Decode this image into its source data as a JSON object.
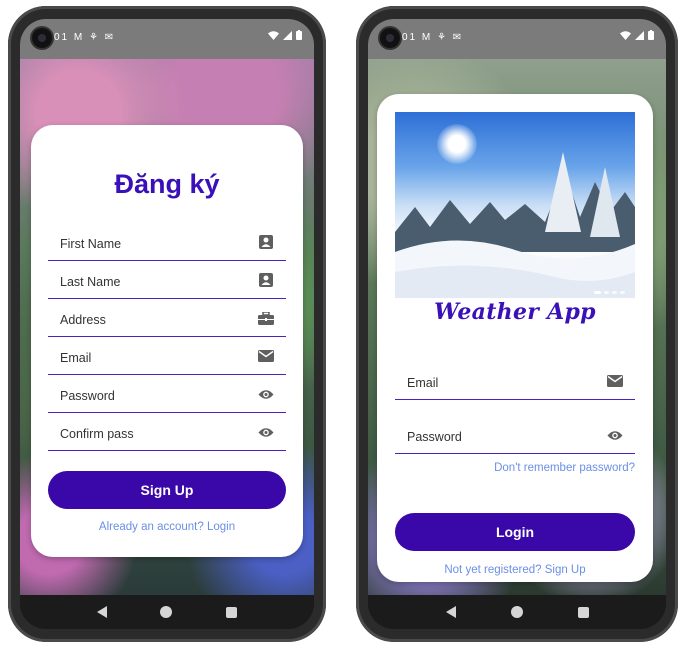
{
  "colors": {
    "accent": "#3a08a8",
    "title": "#3a10b8",
    "link": "#6a8fe6",
    "underline": "#4a22c2"
  },
  "status_left": "01 M ⚘ ✉",
  "signup_screen": {
    "title": "Đăng ký",
    "fields": [
      {
        "label": "First Name",
        "icon": "contact-card-icon"
      },
      {
        "label": "Last Name",
        "icon": "contact-card-icon"
      },
      {
        "label": "Address",
        "icon": "briefcase-icon"
      },
      {
        "label": "Email",
        "icon": "mail-icon"
      },
      {
        "label": "Password",
        "icon": "eye-icon"
      },
      {
        "label": "Confirm pass",
        "icon": "eye-icon"
      }
    ],
    "signup_button": "Sign Up",
    "login_link": "Already an account? Login"
  },
  "login_screen": {
    "brand_title": "Weather App",
    "fields": [
      {
        "label": "Email",
        "icon": "mail-icon"
      },
      {
        "label": "Password",
        "icon": "eye-icon"
      }
    ],
    "forgot_link": "Don't remember password?",
    "login_button": "Login",
    "register_link": "Not yet registered? Sign Up"
  }
}
